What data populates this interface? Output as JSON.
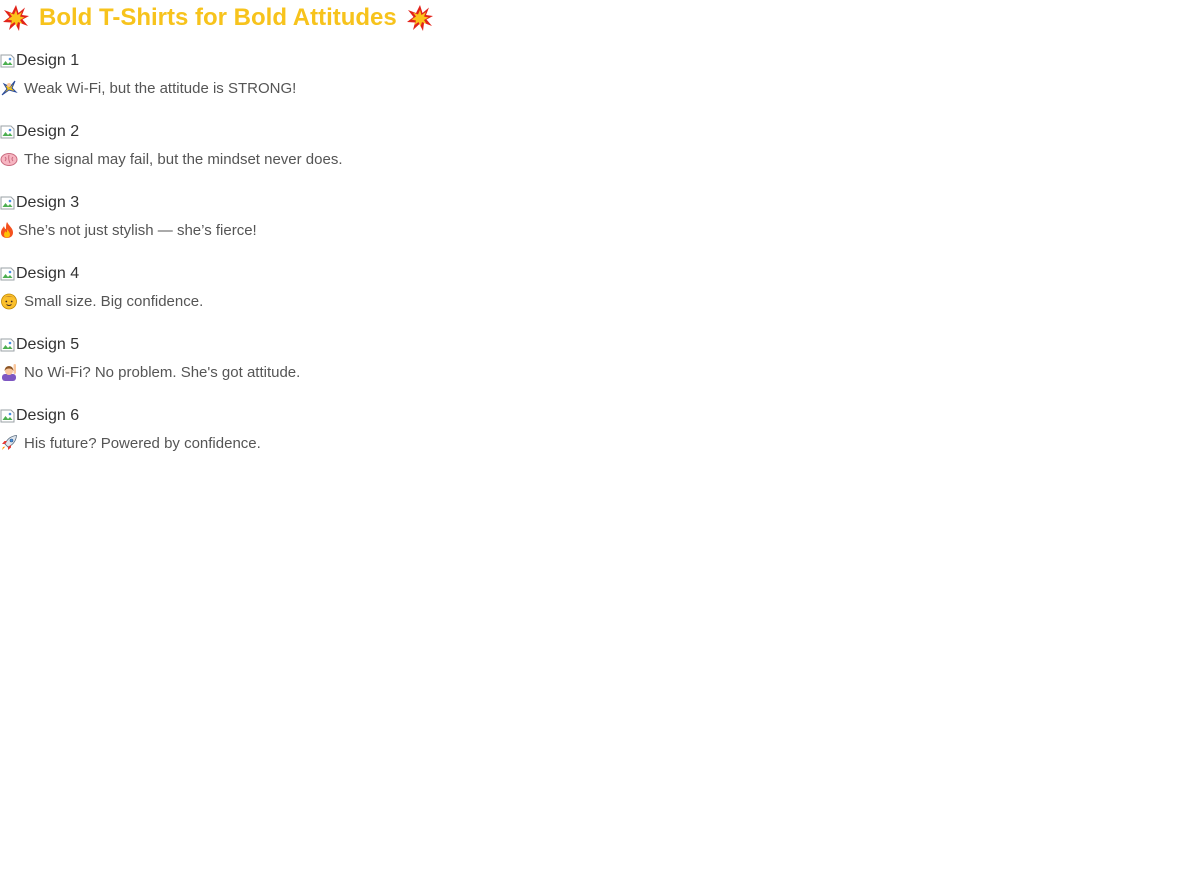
{
  "page": {
    "title": "Bold T-Shirts for Bold Attitudes",
    "title_emoji": "💥",
    "title_emoji_icon": "collision-icon",
    "title_color": "#f7c31c"
  },
  "designs": [
    {
      "image_alt": "Design 1",
      "caption_emoji": "🦸",
      "caption_icon": "superhero-icon",
      "caption": "Weak Wi-Fi, but the attitude is STRONG!"
    },
    {
      "image_alt": "Design 2",
      "caption_emoji": "🧠",
      "caption_icon": "brain-icon",
      "caption": "The signal may fail, but the mindset never does."
    },
    {
      "image_alt": "Design 3",
      "caption_emoji": "🔥",
      "caption_icon": "fire-icon",
      "caption": "She’s not just stylish — she’s fierce!"
    },
    {
      "image_alt": "Design 4",
      "caption_emoji": "🧒",
      "caption_icon": "child-face-icon",
      "caption": "Small size. Big confidence."
    },
    {
      "image_alt": "Design 5",
      "caption_emoji": "🙋",
      "caption_icon": "person-raising-hand-icon",
      "caption": "No Wi-Fi? No problem. She's got attitude."
    },
    {
      "image_alt": "Design 6",
      "caption_emoji": "🚀",
      "caption_icon": "rocket-icon",
      "caption": "His future? Powered by confidence."
    }
  ]
}
